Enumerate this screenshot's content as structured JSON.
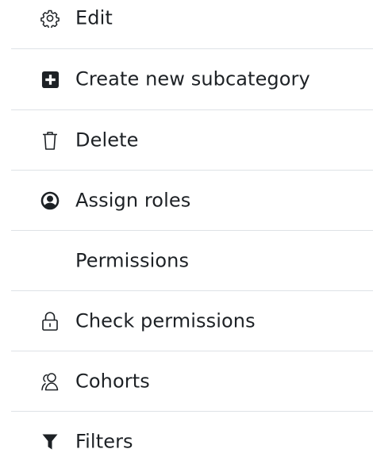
{
  "menu": {
    "items": [
      {
        "label": "Edit",
        "icon": "gear-icon"
      },
      {
        "label": "Create new subcategory",
        "icon": "plus-square-icon"
      },
      {
        "label": "Delete",
        "icon": "trash-icon"
      },
      {
        "label": "Assign roles",
        "icon": "user-circle-icon"
      },
      {
        "label": "Permissions",
        "icon": ""
      },
      {
        "label": "Check permissions",
        "icon": "unlock-icon"
      },
      {
        "label": "Cohorts",
        "icon": "users-icon"
      },
      {
        "label": "Filters",
        "icon": "filter-icon"
      }
    ]
  },
  "colors": {
    "text": "#1d2125",
    "divider": "#dee2e6",
    "background": "#ffffff"
  }
}
